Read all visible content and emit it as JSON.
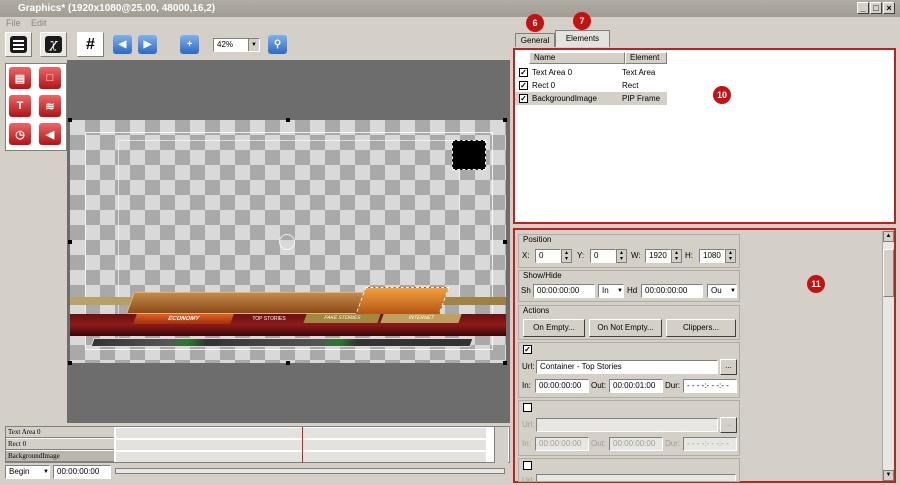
{
  "title": "Graphics* (1920x1080@25.00, 48000,16,2)",
  "window_controls": {
    "minimize": "_",
    "maximize": "□",
    "close": "×"
  },
  "menu": [
    "File",
    "Edit"
  ],
  "zoom": "42%",
  "tabs": [
    "General",
    "Elements"
  ],
  "markers": {
    "m6": "6",
    "m7": "7",
    "m10": "10",
    "m11": "11"
  },
  "elements_table": {
    "headers": [
      "Name",
      "Element"
    ],
    "rows": [
      {
        "name": "Text Area 0",
        "element": "Text Area",
        "checked": true
      },
      {
        "name": "Rect 0",
        "element": "Rect",
        "checked": true
      },
      {
        "name": "BackgroundImage",
        "element": "PIP Frame",
        "checked": true
      }
    ]
  },
  "lower_third": {
    "tab1": "ECONOMY",
    "tab2": "TOP STORIES",
    "tab3": "FAKE STORIES",
    "tab4": "INTERNET"
  },
  "timeline": {
    "tracks": [
      "Text Area 0",
      "Rect 0",
      "BackgroundImage"
    ],
    "start_label": "Begin",
    "time": "00:00:00:00"
  },
  "props": {
    "position": {
      "title": "Position",
      "x_label": "X:",
      "x": "0",
      "y_label": "Y:",
      "y": "0",
      "w_label": "W:",
      "w": "1920",
      "h_label": "H:",
      "h": "1080"
    },
    "showhide": {
      "title": "Show/Hide",
      "sh_label": "Sh",
      "sh": "00:00:00:00",
      "in": "In",
      "hd_label": "Hd",
      "hd": "00:00:00:00",
      "out": "Ou"
    },
    "actions": {
      "title": "Actions",
      "btn1": "On Empty...",
      "btn2": "On Not Empty...",
      "btn3": "Clippers..."
    },
    "action1": {
      "checked": true,
      "url_label": "Url:",
      "url": "Container - Top Stories",
      "browse": "...",
      "in_label": "In:",
      "in": "00:00:00:00",
      "out_label": "Out:",
      "out": "00:00:01:00",
      "dur_label": "Dur:",
      "dur": "- - - -:- - -:- -"
    },
    "action2": {
      "checked": false,
      "url_label": "Url:",
      "url": "",
      "browse": "...",
      "in_label": "In:",
      "in": "00:00:00:00",
      "out_label": "Out:",
      "out": "00:00:00:00",
      "dur_label": "Dur:",
      "dur": "- - - -:- - -:- -"
    },
    "action3": {
      "url_label": "Url:"
    }
  }
}
